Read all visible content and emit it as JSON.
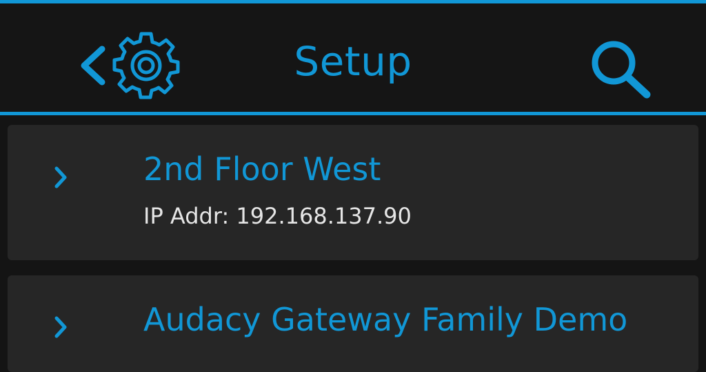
{
  "header": {
    "title": "Setup",
    "back_icon": "chevron-left-icon",
    "settings_icon": "gear-icon",
    "search_icon": "search-icon"
  },
  "devices": [
    {
      "name": "2nd Floor West",
      "ip": "IP Addr: 192.168.137.90",
      "icon": "chevron-right-icon"
    },
    {
      "name": "Audacy Gateway Family Demo",
      "icon": "chevron-right-icon"
    }
  ],
  "colors": {
    "accent": "#1197d6",
    "background": "#141414",
    "card": "#262626",
    "text": "#e6e6e6"
  }
}
